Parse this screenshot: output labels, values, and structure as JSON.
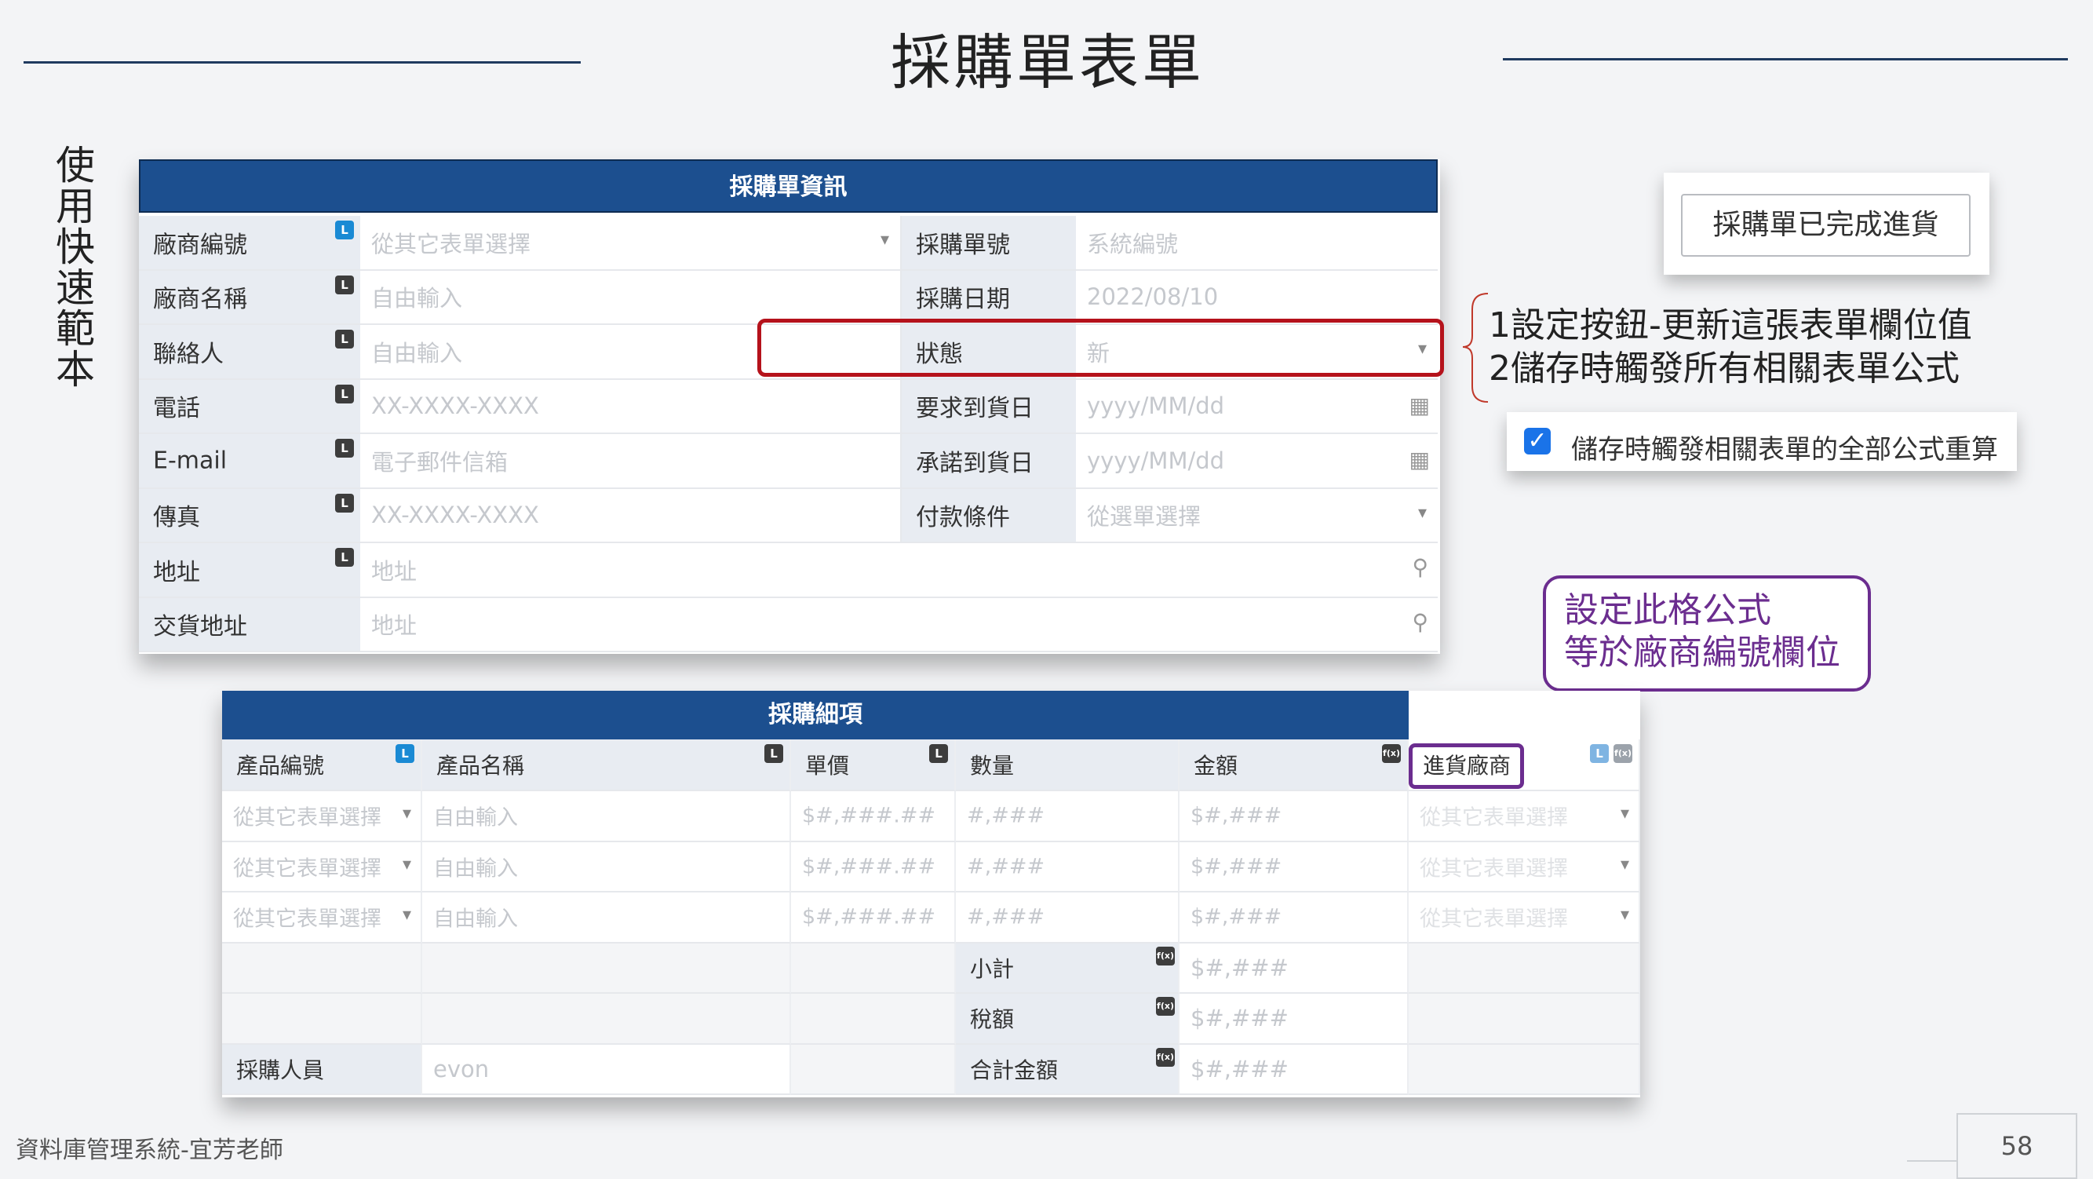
{
  "slide": {
    "title": "採購單表單",
    "side_label": "使用快速範本",
    "footer": "資料庫管理系統-宜芳老師",
    "page_number": "58"
  },
  "purchase_info": {
    "header": "採購單資訊",
    "left_rows": [
      {
        "label": "廠商編號",
        "value": "從其它表單選擇",
        "badge": "L",
        "badge_color": "#1a8ad4",
        "widget": "dropdown"
      },
      {
        "label": "廠商名稱",
        "value": "自由輸入",
        "badge": "L",
        "badge_color": "#3d3d3d"
      },
      {
        "label": "聯絡人",
        "value": "自由輸入",
        "badge": "L",
        "badge_color": "#3d3d3d"
      },
      {
        "label": "電話",
        "value": "XX-XXXX-XXXX",
        "badge": "L",
        "badge_color": "#3d3d3d"
      },
      {
        "label": "E-mail",
        "value": "電子郵件信箱",
        "badge": "L",
        "badge_color": "#3d3d3d"
      },
      {
        "label": "傳真",
        "value": "XX-XXXX-XXXX",
        "badge": "L",
        "badge_color": "#3d3d3d"
      }
    ],
    "right_rows": [
      {
        "label": "採購單號",
        "value": "系統編號"
      },
      {
        "label": "採購日期",
        "value": "2022/08/10"
      },
      {
        "label": "狀態",
        "value": "新",
        "widget": "dropdown"
      },
      {
        "label": "要求到貨日",
        "value": "yyyy/MM/dd",
        "widget": "calendar"
      },
      {
        "label": "承諾到貨日",
        "value": "yyyy/MM/dd",
        "widget": "calendar"
      },
      {
        "label": "付款條件",
        "value": "從選單選擇",
        "widget": "dropdown"
      }
    ],
    "full_rows": [
      {
        "label": "地址",
        "value": "地址",
        "badge": "L",
        "badge_color": "#3d3d3d",
        "widget": "map-pin"
      },
      {
        "label": "交貨地址",
        "value": "地址",
        "widget": "map-pin"
      }
    ]
  },
  "complete_button": "採購單已完成進貨",
  "notes": [
    "1設定按鈕-更新這張表單欄位值",
    "2儲存時觸發所有相關表單公式"
  ],
  "recalc_checkbox": {
    "checked": true,
    "label": "儲存時觸發相關表單的全部公式重算",
    "checkmark": "✓"
  },
  "speech_bubble": [
    "設定此格公式",
    "等於廠商編號欄位"
  ],
  "detail": {
    "header": "採購細項",
    "columns": [
      {
        "label": "產品編號",
        "badges": [
          "L"
        ]
      },
      {
        "label": "產品名稱",
        "badges": [
          "L"
        ]
      },
      {
        "label": "單價",
        "badges": [
          "L"
        ]
      },
      {
        "label": "數量",
        "badges": []
      },
      {
        "label": "金額",
        "badges": [
          "f(x)"
        ]
      },
      {
        "label": "進貨廠商",
        "badges": [
          "L",
          "f(x)"
        ]
      }
    ],
    "rows": [
      [
        "從其它表單選擇",
        "自由輸入",
        "$#,###.##",
        "#,###",
        "$#,###",
        "從其它表單選擇"
      ],
      [
        "從其它表單選擇",
        "自由輸入",
        "$#,###.##",
        "#,###",
        "$#,###",
        "從其它表單選擇"
      ],
      [
        "從其它表單選擇",
        "自由輸入",
        "$#,###.##",
        "#,###",
        "$#,###",
        "從其它表單選擇"
      ]
    ],
    "totals": [
      {
        "label": "小計",
        "value": "$#,###",
        "badge": "f(x)"
      },
      {
        "label": "稅額",
        "value": "$#,###",
        "badge": "f(x)"
      },
      {
        "label": "合計金額",
        "value": "$#,###",
        "badge": "f(x)"
      }
    ],
    "buyer_label": "採購人員",
    "buyer_value": "evon"
  },
  "icons": {
    "dropdown": "▾",
    "calendar": "▦",
    "map_pin": "⚲"
  }
}
